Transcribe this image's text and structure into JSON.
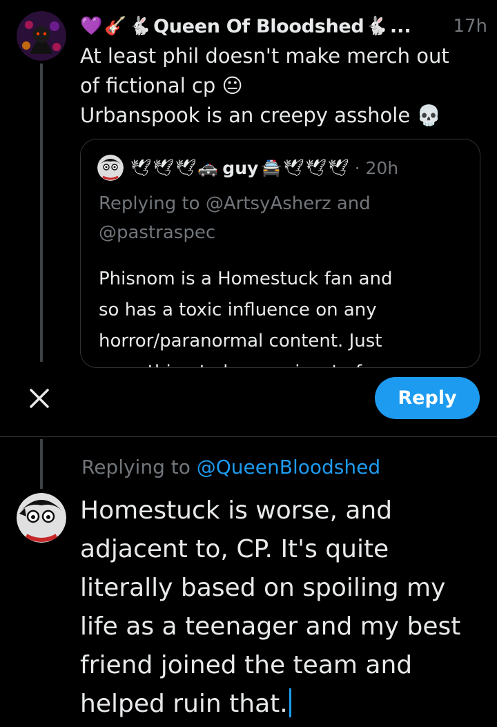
{
  "original_tweet": {
    "emoji_prefix": [
      "💜",
      "🎸",
      "🐇"
    ],
    "author": "Queen Of Bloodshed",
    "emoji_suffix": "🐇",
    "ellipsis": "...",
    "time": "17h",
    "text": "At least phil doesn't make merch out\nof fictional cp 😐\nUrbanspook is an creepy asshole 💀"
  },
  "quoted_tweet": {
    "emoji_before": [
      "🕊",
      "🕊",
      "🕊",
      "🚓"
    ],
    "author": "guy",
    "emoji_after": [
      "🚔",
      "🕊",
      "🕊",
      "🕊"
    ],
    "time": "· 20h",
    "replying_to": "Replying to @ArtsyAsherz and\n@pastraspec",
    "text": "Phisnom is a Homestuck fan and\nso has a toxic influence on any\nhorror/paranormal content. Just\nsomething to be cognizant of."
  },
  "composer": {
    "reply_button": "Reply",
    "replying_prefix": "Replying to ",
    "replying_handle": "@QueenBloodshed",
    "draft": "Homestuck is worse, and\nadjacent to, CP. It's quite\nliterally based on spoiling my\nlife as a teenager and my best\nfriend joined the team and\nhelped ruin that."
  },
  "colors": {
    "accent": "#1d9bf0",
    "muted": "#71767b",
    "background": "#000000"
  },
  "icons": [
    "close-icon"
  ]
}
